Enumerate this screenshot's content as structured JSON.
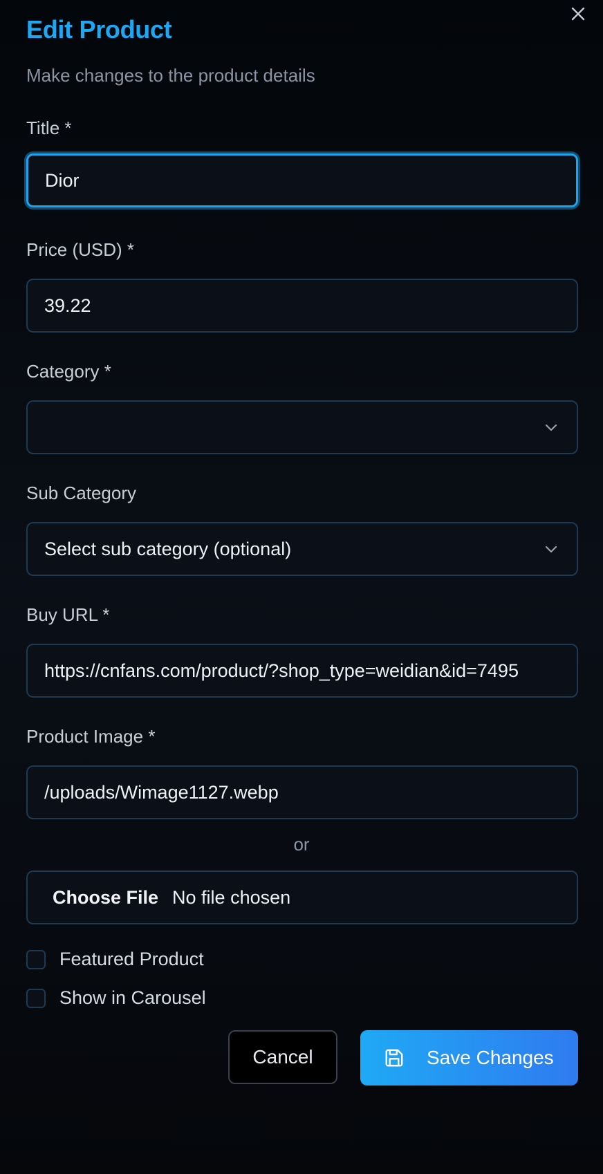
{
  "dialog": {
    "title": "Edit Product",
    "subtitle": "Make changes to the product details",
    "close_icon": "close-icon"
  },
  "form": {
    "title": {
      "label": "Title *",
      "value": "Dior"
    },
    "price": {
      "label": "Price (USD) *",
      "value": "39.22"
    },
    "category": {
      "label": "Category *",
      "value": "",
      "icon": "chevron-down-icon"
    },
    "sub_category": {
      "label": "Sub Category",
      "value": "Select sub category (optional)",
      "icon": "chevron-down-icon"
    },
    "buy_url": {
      "label": "Buy URL *",
      "value": "https://cnfans.com/product/?shop_type=weidian&id=7495"
    },
    "product_image": {
      "label": "Product Image *",
      "value": "/uploads/Wimage1127.webp"
    },
    "or_text": "or",
    "file": {
      "button_label": "Choose File",
      "status": "No file chosen"
    },
    "featured": {
      "label": "Featured Product",
      "checked": false
    },
    "carousel": {
      "label": "Show in Carousel",
      "checked": false
    }
  },
  "actions": {
    "cancel_label": "Cancel",
    "save_label": "Save Changes",
    "save_icon": "save-icon"
  },
  "colors": {
    "accent": "#1ea7f2",
    "button_gradient_start": "#1fa9f5",
    "button_gradient_end": "#2f7bf0",
    "field_border": "#1d3a52"
  }
}
